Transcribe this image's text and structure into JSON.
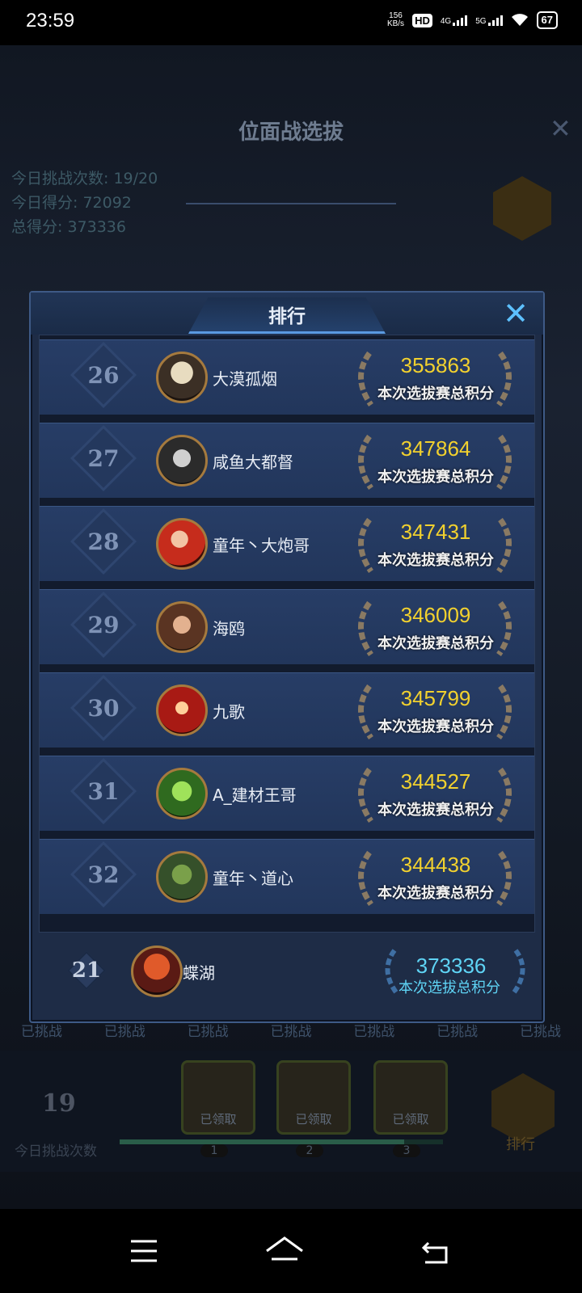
{
  "status_bar": {
    "time": "23:59",
    "net_speed_value": "156",
    "net_speed_unit": "KB/s",
    "hd_label": "HD",
    "network_4g": "4G",
    "network_5g": "5G",
    "battery": "67"
  },
  "background": {
    "title": "位面战选拔",
    "stats": [
      "今日挑战次数: 19/20",
      "今日得分: 72092",
      "总得分: 373336"
    ],
    "challenged_labels": [
      "已挑战",
      "已挑战",
      "已挑战",
      "已挑战",
      "已挑战",
      "已挑战",
      "已挑战"
    ],
    "today_count": "19",
    "today_count_label": "今日挑战次数",
    "chests": [
      {
        "label": "已领取",
        "number": "1"
      },
      {
        "label": "已领取",
        "number": "2"
      },
      {
        "label": "已领取",
        "number": "3"
      }
    ],
    "ranking_button_label": "排行"
  },
  "panel": {
    "title": "排行",
    "score_caption": "本次选拔赛总积分",
    "rows": [
      {
        "rank": "26",
        "name": "大漠孤烟",
        "score": "355863"
      },
      {
        "rank": "27",
        "name": "咸鱼大都督",
        "score": "347864"
      },
      {
        "rank": "28",
        "name": "童年丶大炮哥",
        "score": "347431"
      },
      {
        "rank": "29",
        "name": "海鸥",
        "score": "346009"
      },
      {
        "rank": "30",
        "name": "九歌",
        "score": "345799"
      },
      {
        "rank": "31",
        "name": "A_建材王哥",
        "score": "344527"
      },
      {
        "rank": "32",
        "name": "童年丶道心",
        "score": "344438"
      }
    ],
    "me": {
      "rank": "21",
      "name": "蝶湖",
      "score": "373336",
      "caption": "本次选拔总积分"
    }
  },
  "colors": {
    "accent_blue": "#5dc0ff",
    "score_gold": "#f2d12e",
    "self_score": "#5fd4f5"
  }
}
